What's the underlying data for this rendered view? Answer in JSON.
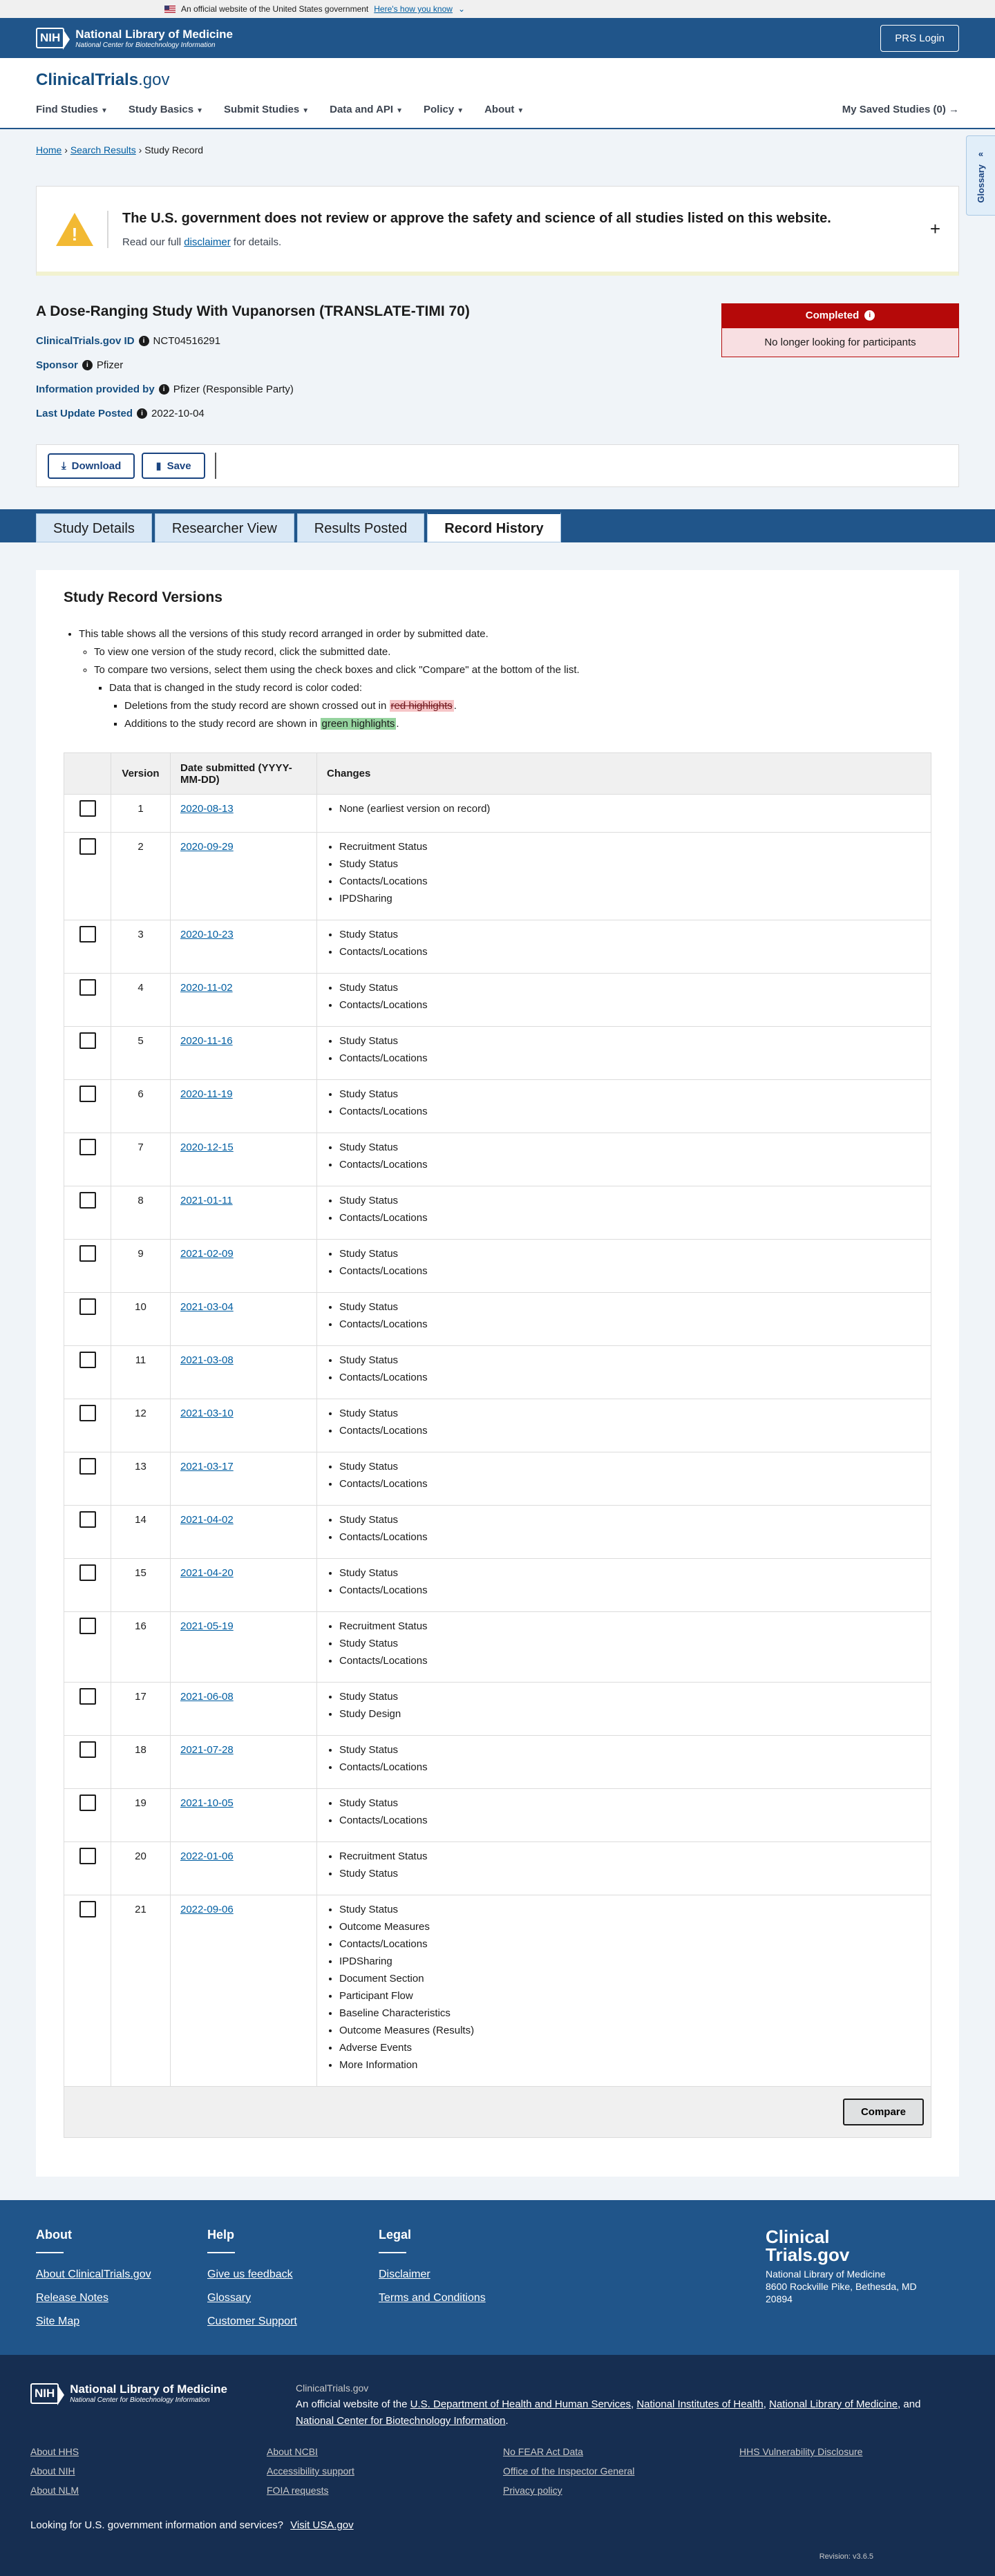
{
  "gov_banner": {
    "text": "An official website of the United States government",
    "link": "Here's how you know"
  },
  "nlm": {
    "nih": "NIH",
    "title": "National Library of Medicine",
    "subtitle": "National Center for Biotechnology Information",
    "prs_login": "PRS Login"
  },
  "site": {
    "title_a": "ClinicalTrials",
    "title_b": ".gov"
  },
  "nav": {
    "items": [
      "Find Studies",
      "Study Basics",
      "Submit Studies",
      "Data and API",
      "Policy",
      "About"
    ],
    "saved": "My Saved Studies (0) →"
  },
  "glossary": "Glossary",
  "breadcrumb": {
    "home": "Home",
    "search": "Search Results",
    "current": "Study Record"
  },
  "disclaimer": {
    "title": "The U.S. government does not review or approve the safety and science of all studies listed on this website.",
    "pre": "Read our full",
    "link": "disclaimer",
    "post": "for details."
  },
  "study": {
    "title": "A Dose-Ranging Study With Vupanorsen (TRANSLATE-TIMI 70)",
    "id_label": "ClinicalTrials.gov ID",
    "id_value": "NCT04516291",
    "sponsor_label": "Sponsor",
    "sponsor_value": "Pfizer",
    "provided_label": "Information provided by",
    "provided_value": "Pfizer (Responsible Party)",
    "updated_label": "Last Update Posted",
    "updated_value": "2022-10-04",
    "status": "Completed",
    "recruit": "No longer looking for participants"
  },
  "actions": {
    "download": "Download",
    "save": "Save"
  },
  "tabs": [
    "Study Details",
    "Researcher View",
    "Results Posted",
    "Record History"
  ],
  "history": {
    "heading": "Study Record Versions",
    "intro1": "This table shows all the versions of this study record arranged in order by submitted date.",
    "intro2": "To view one version of the study record, click the submitted date.",
    "intro3": "To compare two versions, select them using the check boxes and click \"Compare\" at the bottom of the list.",
    "intro4": "Data that is changed in the study record is color coded:",
    "del_pre": "Deletions from the study record are shown crossed out in",
    "del_hl": "red highlights",
    "add_pre": "Additions to the study record are shown in",
    "add_hl": "green highlights",
    "col_version": "Version",
    "col_date": "Date submitted (YYYY-MM-DD)",
    "col_changes": "Changes",
    "compare": "Compare",
    "rows": [
      {
        "v": "1",
        "d": "2020-08-13",
        "c": [
          "None (earliest version on record)"
        ]
      },
      {
        "v": "2",
        "d": "2020-09-29",
        "c": [
          "Recruitment Status",
          "Study Status",
          "Contacts/Locations",
          "IPDSharing"
        ]
      },
      {
        "v": "3",
        "d": "2020-10-23",
        "c": [
          "Study Status",
          "Contacts/Locations"
        ]
      },
      {
        "v": "4",
        "d": "2020-11-02",
        "c": [
          "Study Status",
          "Contacts/Locations"
        ]
      },
      {
        "v": "5",
        "d": "2020-11-16",
        "c": [
          "Study Status",
          "Contacts/Locations"
        ]
      },
      {
        "v": "6",
        "d": "2020-11-19",
        "c": [
          "Study Status",
          "Contacts/Locations"
        ]
      },
      {
        "v": "7",
        "d": "2020-12-15",
        "c": [
          "Study Status",
          "Contacts/Locations"
        ]
      },
      {
        "v": "8",
        "d": "2021-01-11",
        "c": [
          "Study Status",
          "Contacts/Locations"
        ]
      },
      {
        "v": "9",
        "d": "2021-02-09",
        "c": [
          "Study Status",
          "Contacts/Locations"
        ]
      },
      {
        "v": "10",
        "d": "2021-03-04",
        "c": [
          "Study Status",
          "Contacts/Locations"
        ]
      },
      {
        "v": "11",
        "d": "2021-03-08",
        "c": [
          "Study Status",
          "Contacts/Locations"
        ]
      },
      {
        "v": "12",
        "d": "2021-03-10",
        "c": [
          "Study Status",
          "Contacts/Locations"
        ]
      },
      {
        "v": "13",
        "d": "2021-03-17",
        "c": [
          "Study Status",
          "Contacts/Locations"
        ]
      },
      {
        "v": "14",
        "d": "2021-04-02",
        "c": [
          "Study Status",
          "Contacts/Locations"
        ]
      },
      {
        "v": "15",
        "d": "2021-04-20",
        "c": [
          "Study Status",
          "Contacts/Locations"
        ]
      },
      {
        "v": "16",
        "d": "2021-05-19",
        "c": [
          "Recruitment Status",
          "Study Status",
          "Contacts/Locations"
        ]
      },
      {
        "v": "17",
        "d": "2021-06-08",
        "c": [
          "Study Status",
          "Study Design"
        ]
      },
      {
        "v": "18",
        "d": "2021-07-28",
        "c": [
          "Study Status",
          "Contacts/Locations"
        ]
      },
      {
        "v": "19",
        "d": "2021-10-05",
        "c": [
          "Study Status",
          "Contacts/Locations"
        ]
      },
      {
        "v": "20",
        "d": "2022-01-06",
        "c": [
          "Recruitment Status",
          "Study Status"
        ]
      },
      {
        "v": "21",
        "d": "2022-09-06",
        "c": [
          "Study Status",
          "Outcome Measures",
          "Contacts/Locations",
          "IPDSharing",
          "Document Section",
          "Participant Flow",
          "Baseline Characteristics",
          "Outcome Measures (Results)",
          "Adverse Events",
          "More Information"
        ]
      }
    ]
  },
  "footer": {
    "about_h": "About",
    "about_links": [
      "About ClinicalTrials.gov",
      "Release Notes",
      "Site Map"
    ],
    "help_h": "Help",
    "help_links": [
      "Give us feedback",
      "Glossary",
      "Customer Support"
    ],
    "legal_h": "Legal",
    "legal_links": [
      "Disclaimer",
      "Terms and Conditions"
    ],
    "brand_l1": "Clinical",
    "brand_l2": "Trials.gov",
    "addr1": "National Library of Medicine",
    "addr2": "8600 Rockville Pike, Bethesda, MD",
    "addr3": "20894"
  },
  "footer2": {
    "ct": "ClinicalTrials.gov",
    "pre": "An official website of the",
    "hhs": "U.S. Department of Health and Human Services",
    "nih": "National Institutes of Health",
    "nlm": "National Library of Medicine",
    "and": "and",
    "ncbi": "National Center for Biotechnology Information",
    "links": [
      "About HHS",
      "About NCBI",
      "No FEAR Act Data",
      "HHS Vulnerability Disclosure",
      "About NIH",
      "Accessibility support",
      "Office of the Inspector General",
      "",
      "About NLM",
      "FOIA requests",
      "Privacy policy",
      ""
    ],
    "usa_pre": "Looking for U.S. government information and services?",
    "usa_link": "Visit USA.gov",
    "revision": "Revision: v3.6.5"
  }
}
